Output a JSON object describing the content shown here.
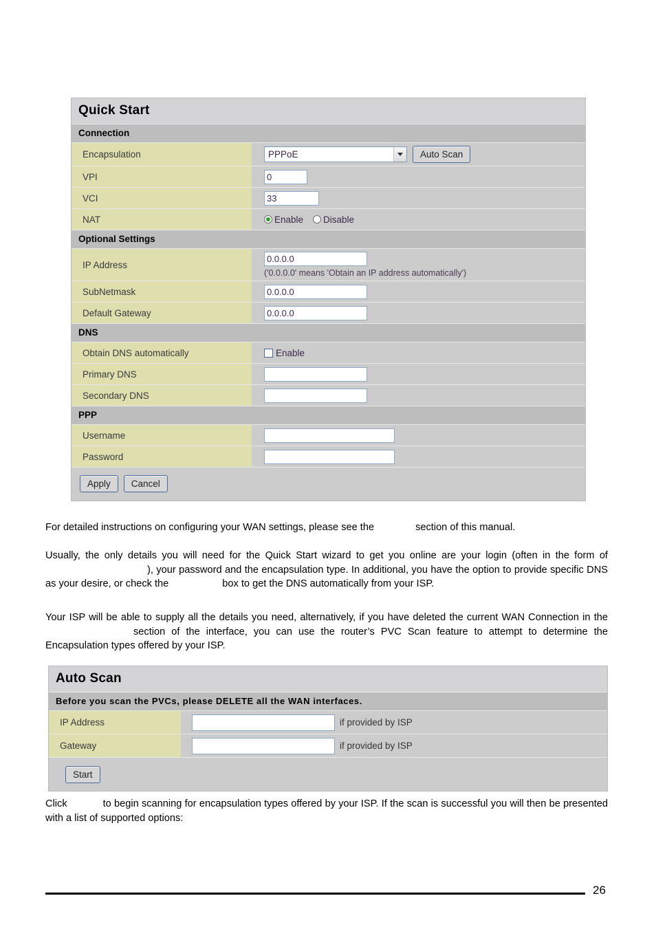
{
  "quick_start": {
    "title": "Quick Start",
    "sections": {
      "connection": "Connection",
      "optional": "Optional Settings",
      "dns": "DNS",
      "ppp": "PPP"
    },
    "fields": {
      "encapsulation_label": "Encapsulation",
      "encapsulation_value": "PPPoE",
      "auto_scan_button": "Auto Scan",
      "vpi_label": "VPI",
      "vpi_value": "0",
      "vci_label": "VCI",
      "vci_value": "33",
      "nat_label": "NAT",
      "nat_enable": "Enable",
      "nat_disable": "Disable",
      "ip_address_label": "IP Address",
      "ip_address_value": "0.0.0.0",
      "ip_address_hint": "('0.0.0.0' means 'Obtain an IP address automatically')",
      "subnetmask_label": "SubNetmask",
      "subnetmask_value": "0.0.0.0",
      "default_gateway_label": "Default Gateway",
      "default_gateway_value": "0.0.0.0",
      "obtain_dns_label": "Obtain DNS automatically",
      "obtain_dns_enable": "Enable",
      "primary_dns_label": "Primary DNS",
      "primary_dns_value": "",
      "secondary_dns_label": "Secondary DNS",
      "secondary_dns_value": "",
      "username_label": "Username",
      "username_value": "",
      "password_label": "Password",
      "password_value": ""
    },
    "buttons": {
      "apply": "Apply",
      "cancel": "Cancel"
    }
  },
  "body_text": {
    "p1_a": "For detailed instructions on configuring your WAN settings, please see the",
    "p1_b": "section of this manual.",
    "p2_a": "Usually, the only details you will need for the Quick Start wizard to get you online are your login (often in the form of",
    "p2_b": "), your password and the encapsulation type.  In additional, you have the option to provide specific DNS as your desire, or check the",
    "p2_c": "box to get the DNS automatically from your ISP.",
    "p3_a": "Your ISP will be able to supply all the details you need, alternatively, if you have deleted the current WAN Connection in the",
    "p3_b": "section of the interface, you can use the router’s PVC Scan feature to attempt to determine the Encapsulation types offered by your ISP.",
    "p4_a": "Click",
    "p4_b": "to begin scanning for encapsulation types offered by your ISP. If the scan is successful you will then be presented with a list of supported options:"
  },
  "auto_scan": {
    "title": "Auto Scan",
    "notice": "Before you scan the PVCs, please DELETE all the WAN interfaces.",
    "fields": {
      "ip_address_label": "IP Address",
      "ip_address_value": "",
      "ip_address_suffix": "if provided by ISP",
      "gateway_label": "Gateway",
      "gateway_value": "",
      "gateway_suffix": "if provided by ISP"
    },
    "buttons": {
      "start": "Start"
    }
  },
  "footer": {
    "page_number": "26"
  }
}
